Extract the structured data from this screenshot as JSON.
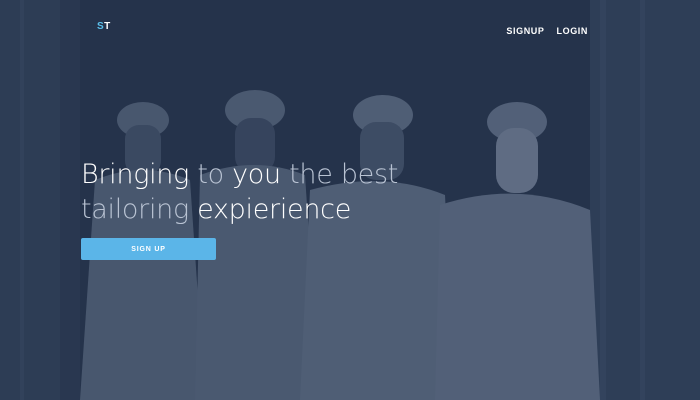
{
  "brand": {
    "logo_s": "S",
    "logo_t": "T"
  },
  "nav": {
    "signup": "SIGNUP",
    "login": "LOGIN"
  },
  "hero": {
    "line1": {
      "w1": "Bringing",
      "w2": "to",
      "w3": "you",
      "w4": "the best"
    },
    "line2": {
      "w1": "tailoring",
      "w2": "expierience"
    },
    "cta_label": "SIGN UP"
  },
  "colors": {
    "accent": "#5bb5e8",
    "overlay": "#2b3a52",
    "muted_text": "#b9c3d3"
  }
}
